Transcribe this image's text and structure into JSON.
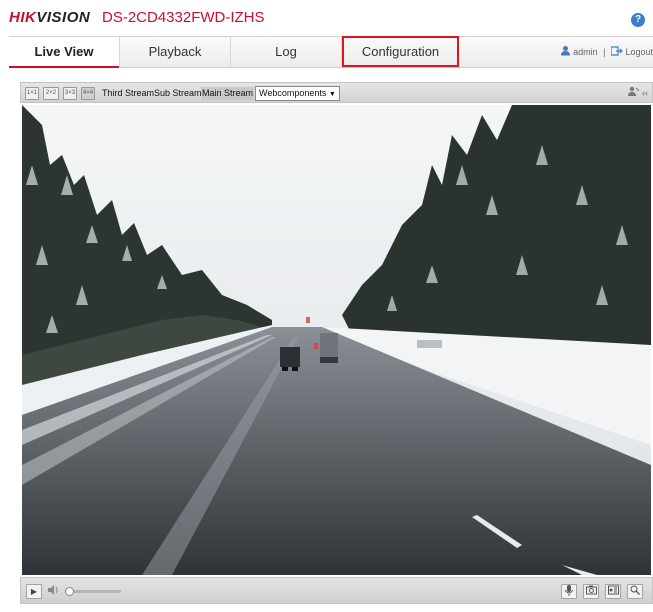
{
  "header": {
    "logo_hik": "HIK",
    "logo_vision": "VISION",
    "model": "DS-2CD4332FWD-IZHS",
    "help_glyph": "?"
  },
  "nav": {
    "tabs": [
      {
        "label": "Live View",
        "active": true
      },
      {
        "label": "Playback",
        "active": false
      },
      {
        "label": "Log",
        "active": false
      },
      {
        "label": "Configuration",
        "active": false,
        "highlighted": true
      }
    ],
    "user": "admin",
    "separator": "|",
    "logout": "Logout"
  },
  "player": {
    "toolbar": {
      "window_buttons": [
        "1×1",
        "2×2",
        "3×3",
        "4×4"
      ],
      "streams": [
        {
          "label": "Third Stream",
          "selected": false
        },
        {
          "label": "Sub Stream",
          "selected": false
        },
        {
          "label": "Main Stream",
          "selected": true
        }
      ],
      "plugin_select": "Webcomponents",
      "plugin_arrow": "▼",
      "collapse_glyph": "‹‹"
    },
    "controls": {
      "play_glyph": "▶",
      "volume_glyph": "🔈",
      "volume_level": 0.0,
      "right_buttons": [
        "mic-icon",
        "camera-icon",
        "record-icon",
        "zoom-icon"
      ]
    }
  },
  "colors": {
    "brand_red": "#c8102e",
    "highlight_box": "#e0151a",
    "help_blue": "#3a7fc8"
  }
}
